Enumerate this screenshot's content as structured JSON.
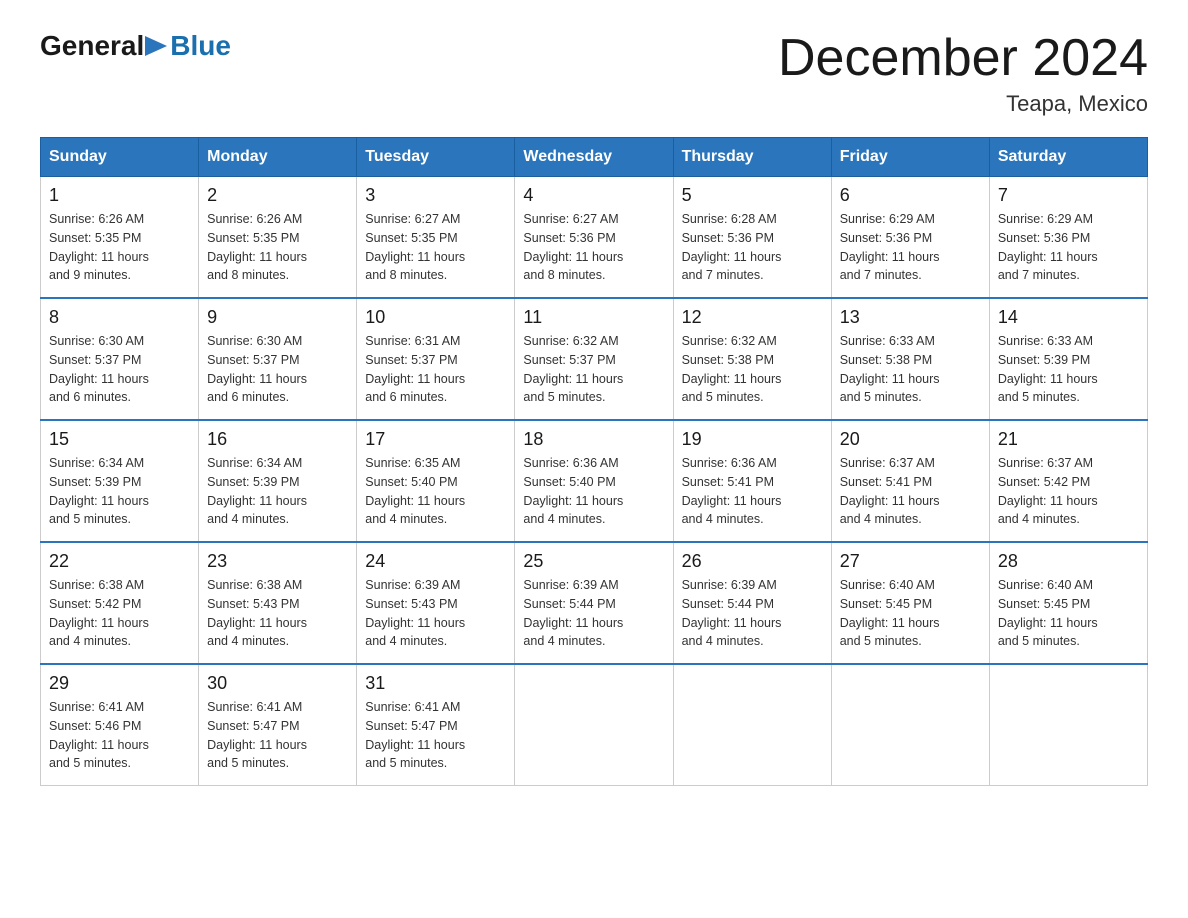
{
  "header": {
    "logo_general": "General",
    "logo_blue": "Blue",
    "title": "December 2024",
    "location": "Teapa, Mexico"
  },
  "days_of_week": [
    "Sunday",
    "Monday",
    "Tuesday",
    "Wednesday",
    "Thursday",
    "Friday",
    "Saturday"
  ],
  "weeks": [
    [
      {
        "day": "1",
        "sunrise": "6:26 AM",
        "sunset": "5:35 PM",
        "daylight": "11 hours and 9 minutes."
      },
      {
        "day": "2",
        "sunrise": "6:26 AM",
        "sunset": "5:35 PM",
        "daylight": "11 hours and 8 minutes."
      },
      {
        "day": "3",
        "sunrise": "6:27 AM",
        "sunset": "5:35 PM",
        "daylight": "11 hours and 8 minutes."
      },
      {
        "day": "4",
        "sunrise": "6:27 AM",
        "sunset": "5:36 PM",
        "daylight": "11 hours and 8 minutes."
      },
      {
        "day": "5",
        "sunrise": "6:28 AM",
        "sunset": "5:36 PM",
        "daylight": "11 hours and 7 minutes."
      },
      {
        "day": "6",
        "sunrise": "6:29 AM",
        "sunset": "5:36 PM",
        "daylight": "11 hours and 7 minutes."
      },
      {
        "day": "7",
        "sunrise": "6:29 AM",
        "sunset": "5:36 PM",
        "daylight": "11 hours and 7 minutes."
      }
    ],
    [
      {
        "day": "8",
        "sunrise": "6:30 AM",
        "sunset": "5:37 PM",
        "daylight": "11 hours and 6 minutes."
      },
      {
        "day": "9",
        "sunrise": "6:30 AM",
        "sunset": "5:37 PM",
        "daylight": "11 hours and 6 minutes."
      },
      {
        "day": "10",
        "sunrise": "6:31 AM",
        "sunset": "5:37 PM",
        "daylight": "11 hours and 6 minutes."
      },
      {
        "day": "11",
        "sunrise": "6:32 AM",
        "sunset": "5:37 PM",
        "daylight": "11 hours and 5 minutes."
      },
      {
        "day": "12",
        "sunrise": "6:32 AM",
        "sunset": "5:38 PM",
        "daylight": "11 hours and 5 minutes."
      },
      {
        "day": "13",
        "sunrise": "6:33 AM",
        "sunset": "5:38 PM",
        "daylight": "11 hours and 5 minutes."
      },
      {
        "day": "14",
        "sunrise": "6:33 AM",
        "sunset": "5:39 PM",
        "daylight": "11 hours and 5 minutes."
      }
    ],
    [
      {
        "day": "15",
        "sunrise": "6:34 AM",
        "sunset": "5:39 PM",
        "daylight": "11 hours and 5 minutes."
      },
      {
        "day": "16",
        "sunrise": "6:34 AM",
        "sunset": "5:39 PM",
        "daylight": "11 hours and 4 minutes."
      },
      {
        "day": "17",
        "sunrise": "6:35 AM",
        "sunset": "5:40 PM",
        "daylight": "11 hours and 4 minutes."
      },
      {
        "day": "18",
        "sunrise": "6:36 AM",
        "sunset": "5:40 PM",
        "daylight": "11 hours and 4 minutes."
      },
      {
        "day": "19",
        "sunrise": "6:36 AM",
        "sunset": "5:41 PM",
        "daylight": "11 hours and 4 minutes."
      },
      {
        "day": "20",
        "sunrise": "6:37 AM",
        "sunset": "5:41 PM",
        "daylight": "11 hours and 4 minutes."
      },
      {
        "day": "21",
        "sunrise": "6:37 AM",
        "sunset": "5:42 PM",
        "daylight": "11 hours and 4 minutes."
      }
    ],
    [
      {
        "day": "22",
        "sunrise": "6:38 AM",
        "sunset": "5:42 PM",
        "daylight": "11 hours and 4 minutes."
      },
      {
        "day": "23",
        "sunrise": "6:38 AM",
        "sunset": "5:43 PM",
        "daylight": "11 hours and 4 minutes."
      },
      {
        "day": "24",
        "sunrise": "6:39 AM",
        "sunset": "5:43 PM",
        "daylight": "11 hours and 4 minutes."
      },
      {
        "day": "25",
        "sunrise": "6:39 AM",
        "sunset": "5:44 PM",
        "daylight": "11 hours and 4 minutes."
      },
      {
        "day": "26",
        "sunrise": "6:39 AM",
        "sunset": "5:44 PM",
        "daylight": "11 hours and 4 minutes."
      },
      {
        "day": "27",
        "sunrise": "6:40 AM",
        "sunset": "5:45 PM",
        "daylight": "11 hours and 5 minutes."
      },
      {
        "day": "28",
        "sunrise": "6:40 AM",
        "sunset": "5:45 PM",
        "daylight": "11 hours and 5 minutes."
      }
    ],
    [
      {
        "day": "29",
        "sunrise": "6:41 AM",
        "sunset": "5:46 PM",
        "daylight": "11 hours and 5 minutes."
      },
      {
        "day": "30",
        "sunrise": "6:41 AM",
        "sunset": "5:47 PM",
        "daylight": "11 hours and 5 minutes."
      },
      {
        "day": "31",
        "sunrise": "6:41 AM",
        "sunset": "5:47 PM",
        "daylight": "11 hours and 5 minutes."
      },
      null,
      null,
      null,
      null
    ]
  ],
  "labels": {
    "sunrise": "Sunrise:",
    "sunset": "Sunset:",
    "daylight": "Daylight:"
  }
}
